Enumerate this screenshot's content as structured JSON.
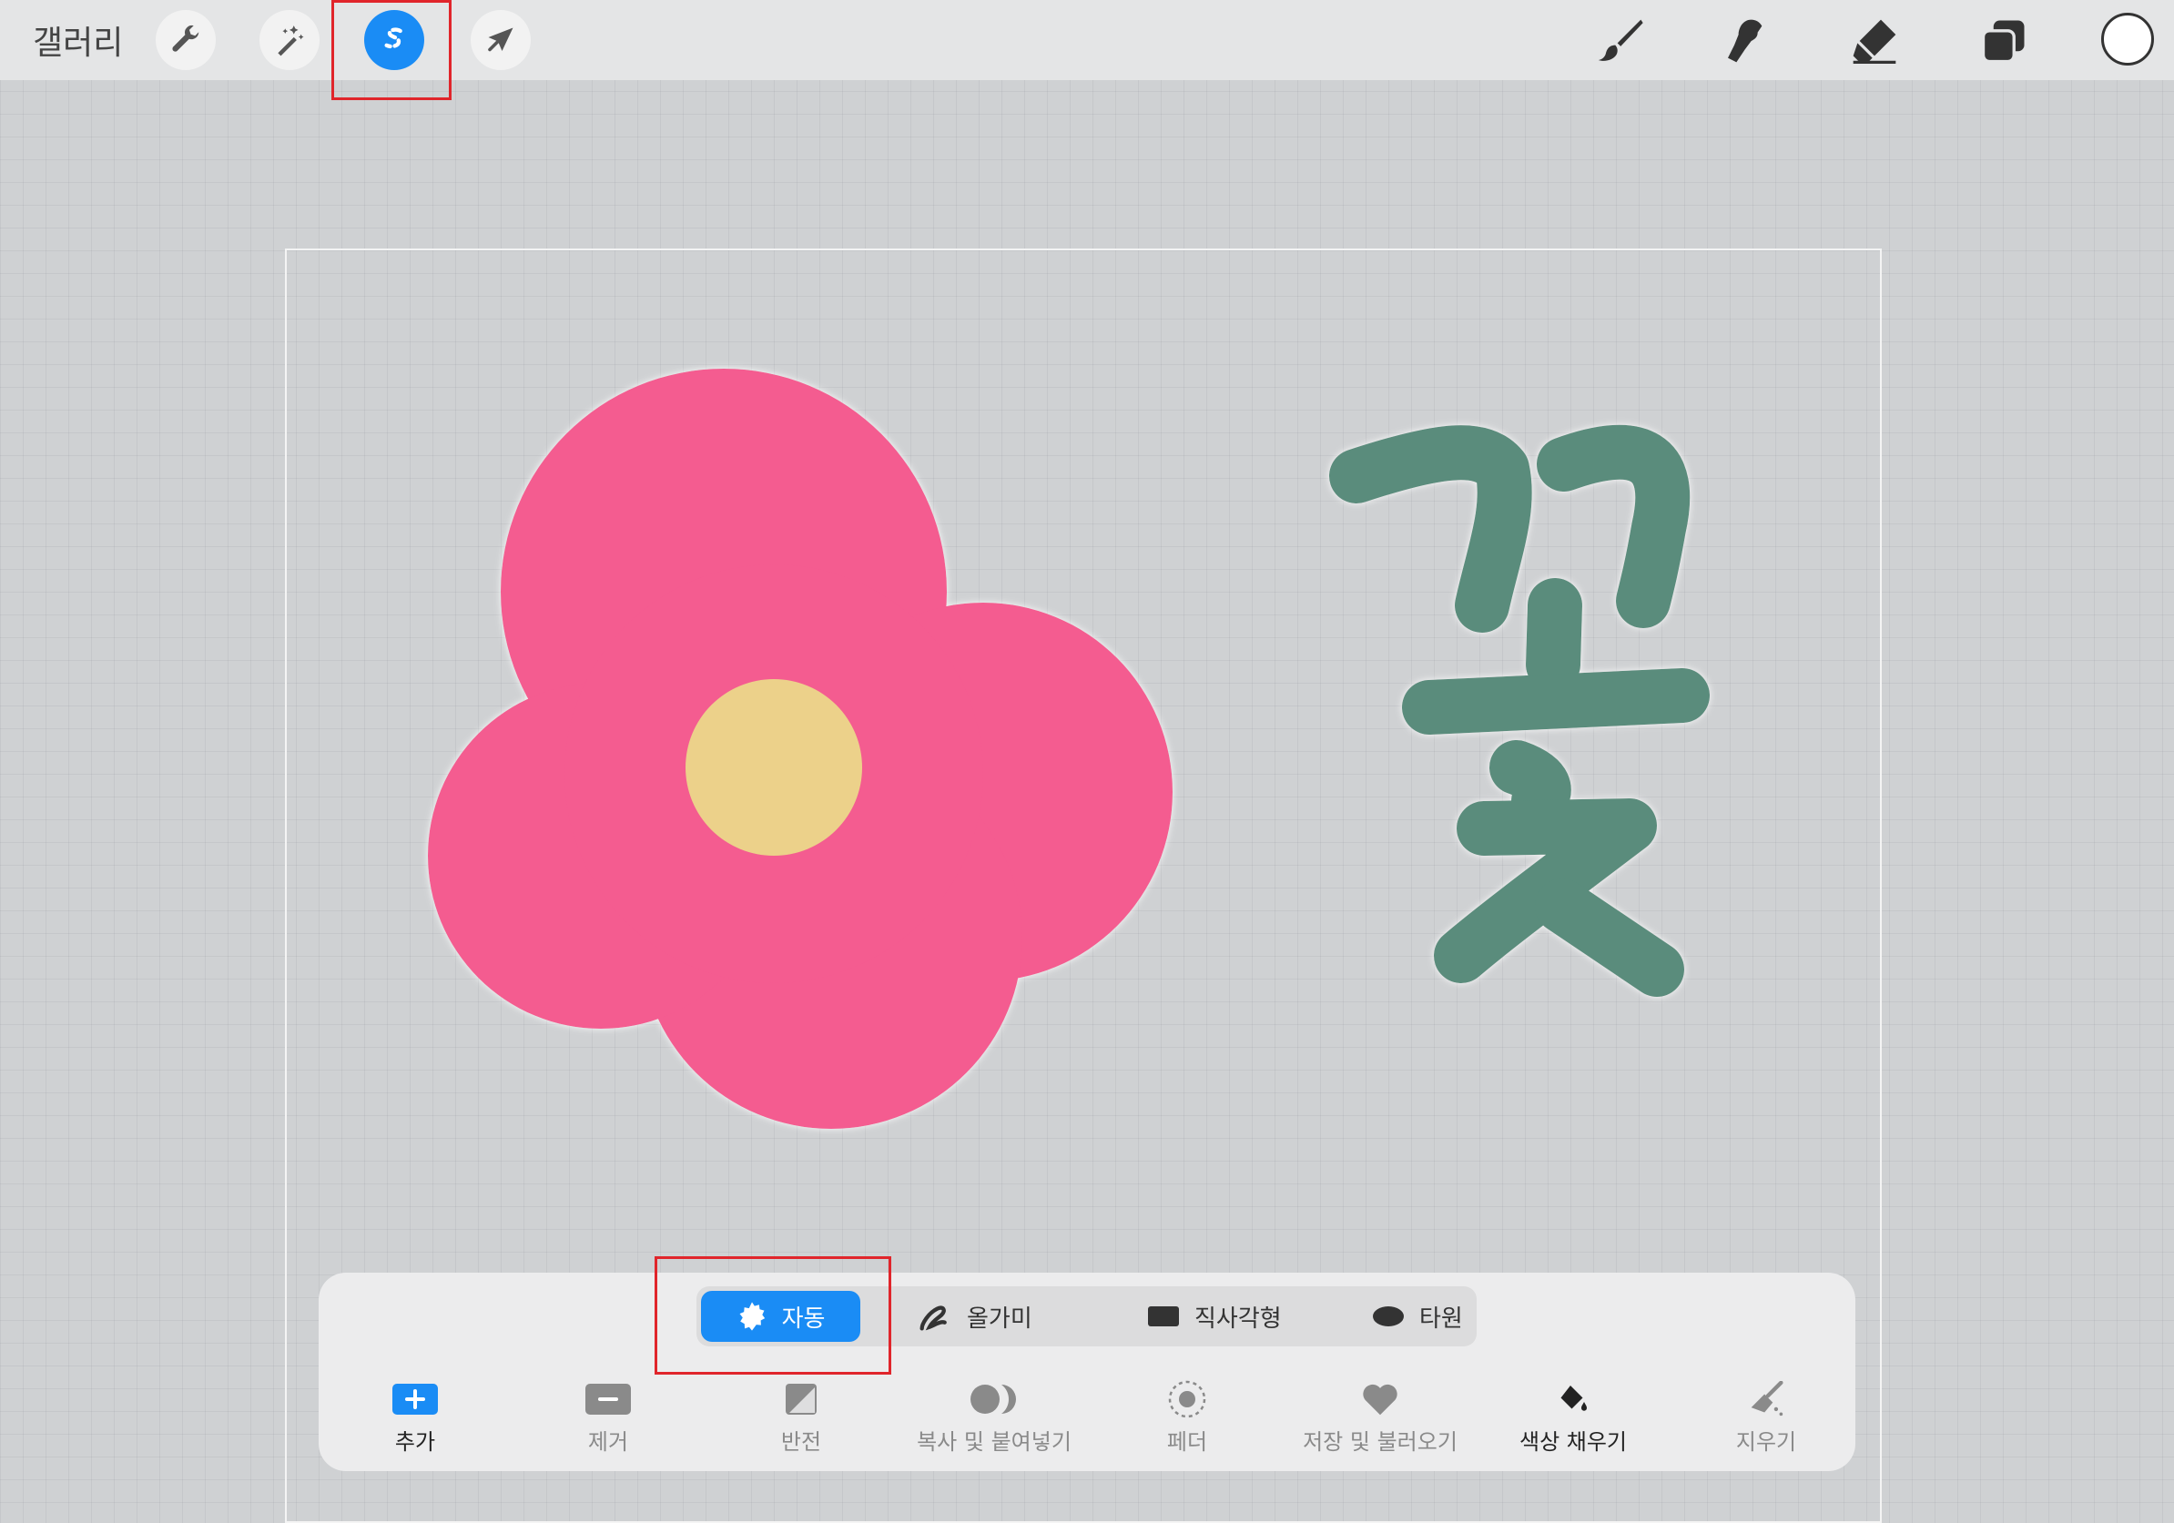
{
  "topbar": {
    "gallery_label": "갤러리",
    "left_tools": [
      {
        "icon": "wrench-icon",
        "name": "Actions"
      },
      {
        "icon": "magic-wand-icon",
        "name": "Adjustments"
      },
      {
        "icon": "selection-icon",
        "name": "Selection",
        "active": true
      },
      {
        "icon": "arrow-cursor-icon",
        "name": "Transform"
      }
    ],
    "right_tools": [
      "brush-icon",
      "smudge-icon",
      "eraser-icon",
      "layers-icon",
      "color-icon"
    ],
    "active_color": "#ffffff",
    "accent": "#1a8cf5"
  },
  "canvas": {
    "hangul_text": "꽃",
    "flower_petal_color": "#f45b90",
    "flower_center_color": "#ecd18a",
    "text_color": "#5a8c7c"
  },
  "selection_panel": {
    "modes": [
      {
        "label": "자동",
        "icon": "auto-icon",
        "selected": true
      },
      {
        "label": "올가미",
        "icon": "lasso-icon"
      },
      {
        "label": "직사각형",
        "icon": "rectangle-icon"
      },
      {
        "label": "타원",
        "icon": "ellipse-icon"
      }
    ],
    "actions": [
      {
        "label": "추가",
        "icon": "plus-icon"
      },
      {
        "label": "제거",
        "icon": "minus-icon"
      },
      {
        "label": "반전",
        "icon": "invert-icon"
      },
      {
        "label": "복사 및 붙여넣기",
        "icon": "copy-paste-icon"
      },
      {
        "label": "페더",
        "icon": "feather-icon"
      },
      {
        "label": "저장 및 불러오기",
        "icon": "heart-icon"
      },
      {
        "label": "색상 채우기",
        "icon": "fill-bucket-icon"
      },
      {
        "label": "지우기",
        "icon": "clear-broom-icon"
      }
    ]
  }
}
